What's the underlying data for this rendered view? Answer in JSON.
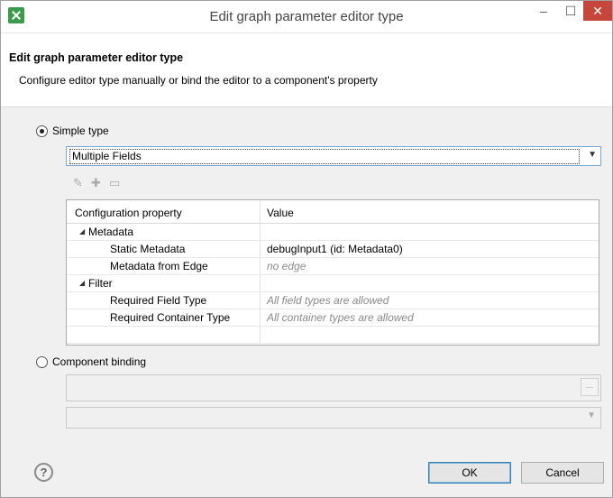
{
  "window": {
    "title": "Edit graph parameter editor type",
    "icon": "cloveretl-app-icon",
    "controls": {
      "minimize": "–",
      "maximize": "☐",
      "close": "✕"
    }
  },
  "banner": {
    "title": "Edit graph parameter editor type",
    "subtitle": "Configure editor type manually or bind the editor to a component's property"
  },
  "simple_type": {
    "label": "Simple type",
    "selected": true,
    "combo_value": "Multiple Fields",
    "toolbar_icons": [
      "edit-icon",
      "add-icon",
      "remove-icon"
    ]
  },
  "table": {
    "headers": [
      "Configuration property",
      "Value"
    ],
    "rows": [
      {
        "property": "Metadata",
        "value": "",
        "group": true
      },
      {
        "property": "Static Metadata",
        "value": "debugInput1 (id: Metadata0)",
        "muted": false
      },
      {
        "property": "Metadata from Edge",
        "value": "no edge",
        "muted": true
      },
      {
        "property": "Filter",
        "value": "",
        "group": true
      },
      {
        "property": "Required Field Type",
        "value": "All field types are allowed",
        "muted": true
      },
      {
        "property": "Required Container Type",
        "value": "All container types are allowed",
        "muted": true
      },
      {
        "property": "",
        "value": ""
      }
    ]
  },
  "component_binding": {
    "label": "Component binding",
    "selected": false,
    "browse_label": "..."
  },
  "footer": {
    "help": "?",
    "ok": "OK",
    "cancel": "Cancel"
  }
}
